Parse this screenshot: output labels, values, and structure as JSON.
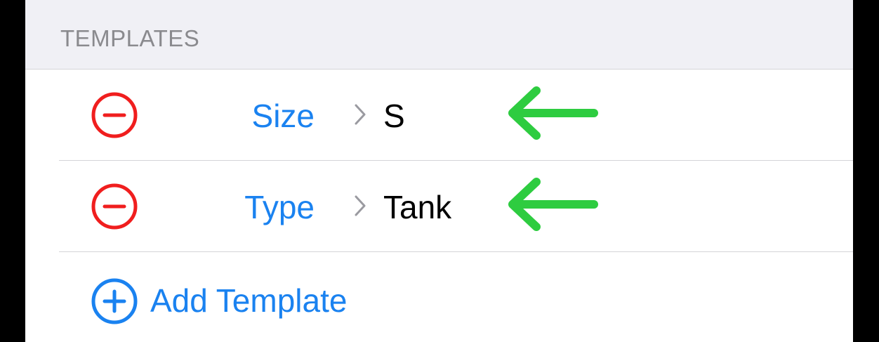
{
  "section": {
    "title": "TEMPLATES"
  },
  "templates": [
    {
      "label": "Size",
      "value": "S"
    },
    {
      "label": "Type",
      "value": "Tank"
    }
  ],
  "add": {
    "label": "Add Template"
  },
  "colors": {
    "accent": "#1a82f0",
    "destructive": "#f01e1e",
    "annotation_arrow": "#2ecc40",
    "section_bg": "#f0f0f5",
    "section_text": "#8a8a8e"
  },
  "icons": {
    "remove": "minus-circle-icon",
    "disclosure": "chevron-right-icon",
    "annotation": "arrow-left-icon",
    "add": "plus-circle-icon"
  }
}
